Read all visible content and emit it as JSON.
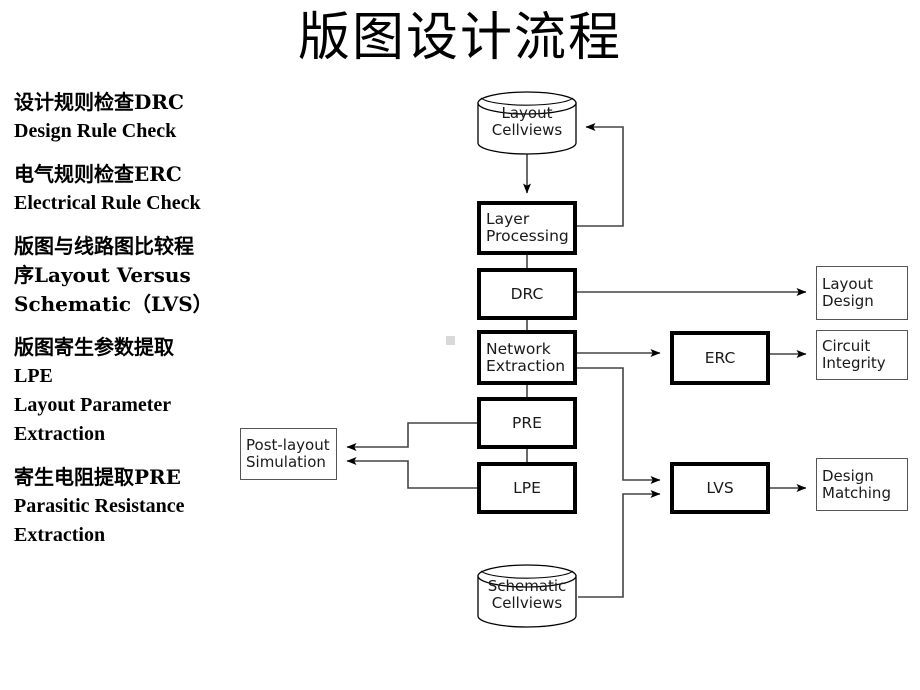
{
  "slide": {
    "title": "版图设计流程"
  },
  "bullets": [
    {
      "lines": [
        "设计规则检查DRC",
        "Design Rule Check"
      ]
    },
    {
      "lines": [
        "电气规则检查ERC",
        "Electrical Rule Check"
      ]
    },
    {
      "lines": [
        "版图与线路图比较程",
        "序Layout Versus",
        "Schematic（LVS）"
      ]
    },
    {
      "lines": [
        "版图寄生参数提取",
        "LPE",
        "Layout Parameter",
        "Extraction"
      ]
    },
    {
      "lines": [
        "寄生电阻提取PRE",
        "Parasitic Resistance",
        "Extraction"
      ]
    }
  ],
  "diagram": {
    "nodes": {
      "layout_cellviews": "Layout\nCellviews",
      "layer_processing": "Layer\nProcessing",
      "drc": "DRC",
      "network_extraction": "Network\nExtraction",
      "pre": "PRE",
      "lpe": "LPE",
      "schematic_cellviews": "Schematic\nCellviews",
      "post_layout_simulation": "Post-layout\nSimulation",
      "erc": "ERC",
      "lvs": "LVS",
      "layout_design": "Layout\nDesign",
      "circuit_integrity": "Circuit\nIntegrity",
      "design_matching": "Design\nMatching"
    },
    "colors": {
      "stroke": "#000000",
      "thin_stroke": "#555555",
      "background": "#ffffff"
    }
  }
}
